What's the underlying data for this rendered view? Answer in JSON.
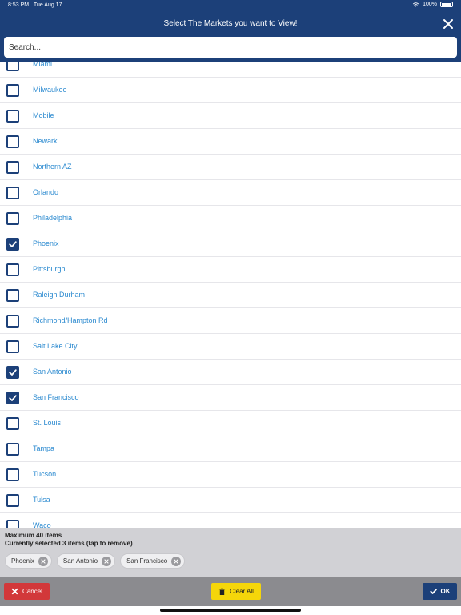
{
  "status": {
    "time": "8:53 PM",
    "date": "Tue Aug 17",
    "battery": "100%"
  },
  "header": {
    "title": "Select The Markets you want to View!"
  },
  "search": {
    "placeholder": "Search..."
  },
  "markets": [
    {
      "label": "Miami",
      "checked": false
    },
    {
      "label": "Milwaukee",
      "checked": false
    },
    {
      "label": "Mobile",
      "checked": false
    },
    {
      "label": "Newark",
      "checked": false
    },
    {
      "label": "Northern AZ",
      "checked": false
    },
    {
      "label": "Orlando",
      "checked": false
    },
    {
      "label": "Philadelphia",
      "checked": false
    },
    {
      "label": "Phoenix",
      "checked": true
    },
    {
      "label": "Pittsburgh",
      "checked": false
    },
    {
      "label": "Raleigh Durham",
      "checked": false
    },
    {
      "label": "Richmond/Hampton Rd",
      "checked": false
    },
    {
      "label": "Salt Lake City",
      "checked": false
    },
    {
      "label": "San Antonio",
      "checked": true
    },
    {
      "label": "San Francisco",
      "checked": true
    },
    {
      "label": "St. Louis",
      "checked": false
    },
    {
      "label": "Tampa",
      "checked": false
    },
    {
      "label": "Tucson",
      "checked": false
    },
    {
      "label": "Tulsa",
      "checked": false
    },
    {
      "label": "Waco",
      "checked": false
    }
  ],
  "footer": {
    "limit_text": "Maximum 40 items",
    "selected_text": "Currently selected 3 items (tap to remove)",
    "chips": [
      "Phoenix",
      "San Antonio",
      "San Francisco"
    ]
  },
  "actions": {
    "cancel": "Cancel",
    "clear": "Clear All",
    "ok": "OK"
  },
  "colors": {
    "header": "#1c4079",
    "link": "#2b8ad0",
    "cancel": "#d2383a",
    "clear": "#f5d60a",
    "ok": "#1c4079"
  }
}
